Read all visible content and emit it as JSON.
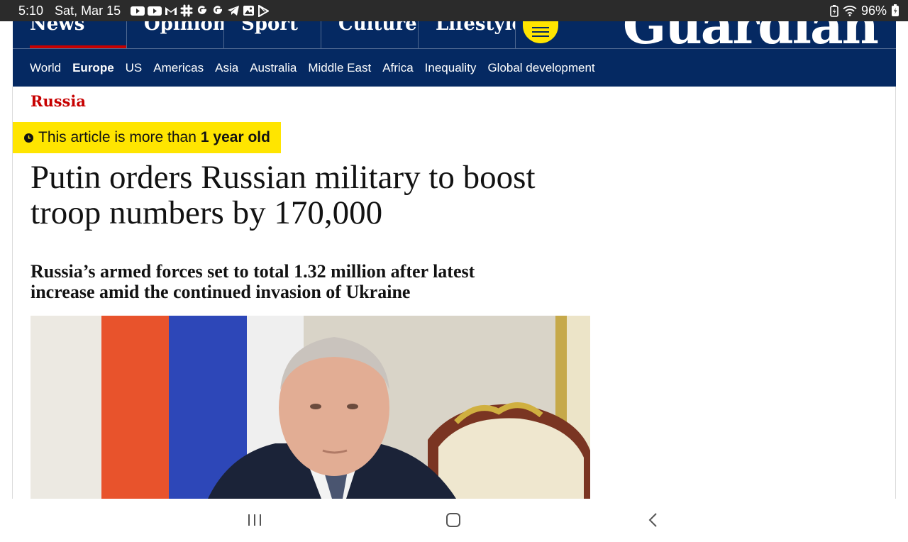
{
  "status_bar": {
    "time": "5:10",
    "date": "Sat, Mar 15",
    "battery": "96%",
    "notification_icons": [
      "youtube-icon",
      "youtube-icon",
      "gmail-icon",
      "slack-icon",
      "google-icon",
      "google-icon",
      "telegram-icon",
      "gallery-icon",
      "play-store-icon"
    ]
  },
  "header": {
    "pillars": [
      "News",
      "Opinion",
      "Sport",
      "Culture",
      "Lifestyle"
    ],
    "active_pillar": "News",
    "logo": "Guardian",
    "subnav": [
      "World",
      "Europe",
      "US",
      "Americas",
      "Asia",
      "Australia",
      "Middle East",
      "Africa",
      "Inequality",
      "Global development"
    ],
    "current_subnav": "Europe"
  },
  "article": {
    "kicker": "Russia",
    "age_banner_prefix": "This article is more than",
    "age_banner_bold": "1 year old",
    "headline": "Putin orders Russian military to boost troop numbers by 170,000",
    "standfirst": "Russia’s armed forces set to total 1.32 million after latest increase amid the continued invasion of Ukraine"
  },
  "colors": {
    "guardian_blue": "#052962",
    "brand_yellow": "#ffe500",
    "kicker_red": "#c70000",
    "status_bar": "#2b2b2b"
  },
  "system_nav": {
    "icons": [
      "recent-apps-icon",
      "home-icon",
      "back-icon"
    ]
  }
}
